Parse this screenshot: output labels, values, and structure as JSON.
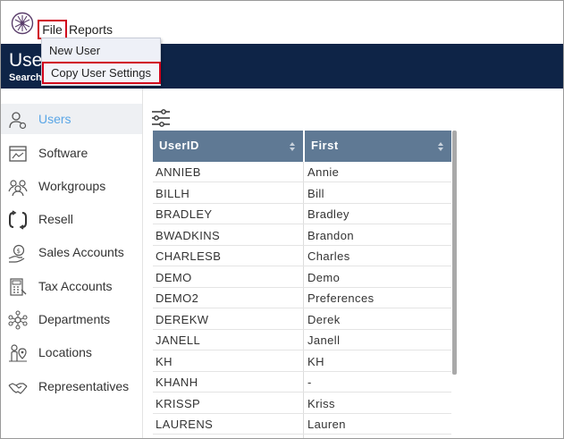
{
  "menu": {
    "file": "File",
    "reports": "Reports",
    "file_dropdown": [
      "New User",
      "Copy User Settings"
    ]
  },
  "header": {
    "title": "Use",
    "search_label": "Search"
  },
  "sidebar": {
    "items": [
      {
        "label": "Users",
        "icon": "user-icon",
        "active": true
      },
      {
        "label": "Software",
        "icon": "software-icon"
      },
      {
        "label": "Workgroups",
        "icon": "workgroups-icon"
      },
      {
        "label": "Resell",
        "icon": "resell-icon"
      },
      {
        "label": "Sales Accounts",
        "icon": "sales-accounts-icon"
      },
      {
        "label": "Tax Accounts",
        "icon": "tax-accounts-icon"
      },
      {
        "label": "Departments",
        "icon": "departments-icon"
      },
      {
        "label": "Locations",
        "icon": "location-icon"
      },
      {
        "label": "Representatives",
        "icon": "handshake-icon"
      }
    ]
  },
  "table": {
    "columns": [
      "UserID",
      "First"
    ],
    "rows": [
      [
        "ANNIEB",
        "Annie"
      ],
      [
        "BILLH",
        "Bill"
      ],
      [
        "BRADLEY",
        "Bradley"
      ],
      [
        "BWADKINS",
        "Brandon"
      ],
      [
        "CHARLESB",
        "Charles"
      ],
      [
        "DEMO",
        "Demo"
      ],
      [
        "DEMO2",
        "Preferences"
      ],
      [
        "DEREKW",
        "Derek"
      ],
      [
        "JANELL",
        "Janell"
      ],
      [
        "KH",
        "KH"
      ],
      [
        "KHANH",
        "-"
      ],
      [
        "KRISSP",
        "Kriss"
      ],
      [
        "LAURENS",
        "Lauren"
      ]
    ]
  },
  "colors": {
    "header_bg": "#0e2447",
    "table_header_bg": "#5f7994",
    "active_item": "#5aa6e6",
    "highlight_border": "#d0021b"
  }
}
